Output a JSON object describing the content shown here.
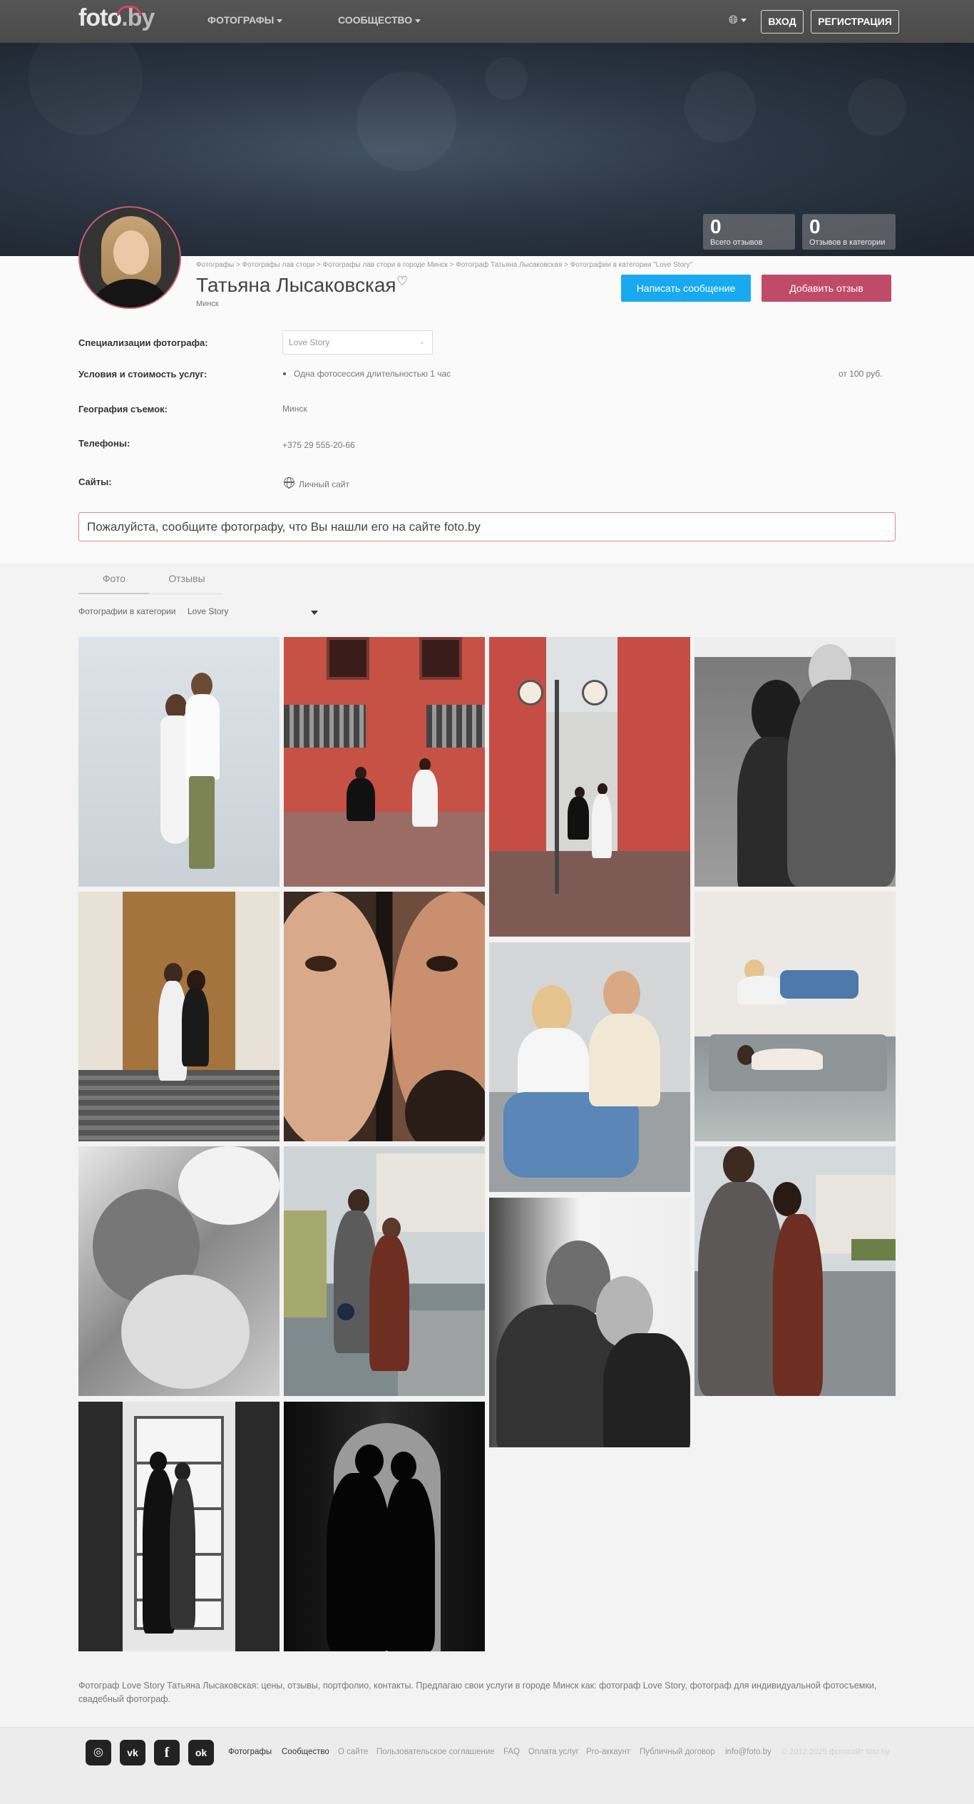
{
  "header": {
    "logo_text": "foto",
    "logo_dot": ".by",
    "nav": [
      {
        "label": "ФОТОГРАФЫ"
      },
      {
        "label": "СООБЩЕСТВО"
      }
    ],
    "language_icon": "globe-icon",
    "login_label": "ВХОД",
    "register_label": "РЕГИСТРАЦИЯ"
  },
  "stats": {
    "total_reviews_num": "0",
    "total_reviews_label": "Всего отзывов",
    "category_reviews_num": "0",
    "category_reviews_label": "Отзывов в категории"
  },
  "profile": {
    "breadcrumb": "Фотографы > Фотографы лав стори > Фотографы лав стори в городе Минск > Фотограф Татьяна Лысаковская > Фотографии в категории \"Love Story\"",
    "name": "Татьяна Лысаковская",
    "city": "Минск",
    "message_button": "Написать сообщение",
    "review_button": "Добавить отзыв"
  },
  "details": {
    "spec_label": "Специализации фотографа:",
    "spec_value": "Love Story",
    "services_label": "Условия и стоимость услуг:",
    "service_item": "Одна фотосессия длительностью 1 час",
    "service_price": "от 100 руб.",
    "geo_label": "География съемок:",
    "geo_value": "Минск",
    "phones_label": "Телефоны:",
    "phone_value": "+375 29 555-20-66",
    "sites_label": "Сайты:",
    "site_value": "Личный сайт"
  },
  "notice": "Пожалуйста, сообщите фотографу, что Вы нашли его на сайте foto.by",
  "tabs": [
    {
      "label": "Фото"
    },
    {
      "label": "Отзывы"
    }
  ],
  "filter": {
    "label": "Фотографии в категории",
    "value": "Love Story"
  },
  "seo_text": "Фотограф Love Story Татьяна Лысаковская: цены, отзывы, портфолио, контакты. Предлагаю свои услуги в городе Минск как: фотограф Love Story, фотограф для индивидуальной фотосъемки, свадебный фотограф.",
  "footer": {
    "social": [
      {
        "icon": "instagram-icon",
        "glyph": "◎"
      },
      {
        "icon": "vk-icon",
        "glyph": "vk"
      },
      {
        "icon": "facebook-icon",
        "glyph": "f"
      },
      {
        "icon": "odnoklassniki-icon",
        "glyph": "ok"
      }
    ],
    "links": [
      {
        "label": "Фотографы"
      },
      {
        "label": "Сообщество"
      },
      {
        "label": "О сайте"
      },
      {
        "label": "Пользовательское соглашение"
      },
      {
        "label": "FAQ"
      },
      {
        "label": "Оплата услуг"
      },
      {
        "label": "Pro-аккаунт"
      },
      {
        "label": "Публичный договор"
      },
      {
        "label": "info@foto.by"
      }
    ],
    "copyright": "© 2012-2025 фотосайт foto.by"
  }
}
